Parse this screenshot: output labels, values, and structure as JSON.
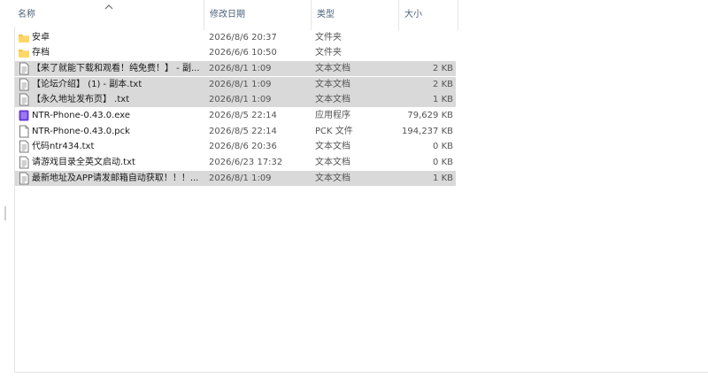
{
  "columns": {
    "name": "名称",
    "date_modified": "修改日期",
    "type": "类型",
    "size": "大小"
  },
  "sort_indicator": "chevron-up-icon",
  "files": [
    {
      "name": "安卓",
      "date": "2026/8/6 20:37",
      "type": "文件夹",
      "size": "",
      "icon": "folder-icon",
      "selected": false
    },
    {
      "name": "存档",
      "date": "2026/6/6 10:50",
      "type": "文件夹",
      "size": "",
      "icon": "folder-icon",
      "selected": false
    },
    {
      "name": "【来了就能下载和观看！纯免费！】 - 副...",
      "date": "2026/8/1 1:09",
      "type": "文本文档",
      "size": "2 KB",
      "icon": "text-file-icon",
      "selected": true
    },
    {
      "name": "【论坛介绍】 (1) - 副本.txt",
      "date": "2026/8/1 1:09",
      "type": "文本文档",
      "size": "2 KB",
      "icon": "text-file-icon",
      "selected": true
    },
    {
      "name": "【永久地址发布页】 .txt",
      "date": "2026/8/1 1:09",
      "type": "文本文档",
      "size": "1 KB",
      "icon": "text-file-icon",
      "selected": true
    },
    {
      "name": "NTR-Phone-0.43.0.exe",
      "date": "2026/8/5 22:14",
      "type": "应用程序",
      "size": "79,629 KB",
      "icon": "app-icon",
      "selected": false
    },
    {
      "name": "NTR-Phone-0.43.0.pck",
      "date": "2026/8/5 22:14",
      "type": "PCK 文件",
      "size": "194,237 KB",
      "icon": "blank-file-icon",
      "selected": false
    },
    {
      "name": "代码ntr434.txt",
      "date": "2026/8/6 20:36",
      "type": "文本文档",
      "size": "0 KB",
      "icon": "text-file-icon",
      "selected": false
    },
    {
      "name": "请游戏目录全英文启动.txt",
      "date": "2026/6/23 17:32",
      "type": "文本文档",
      "size": "0 KB",
      "icon": "text-file-icon",
      "selected": false
    },
    {
      "name": "最新地址及APP请发邮箱自动获取！！！...",
      "date": "2026/8/1 1:09",
      "type": "文本文档",
      "size": "1 KB",
      "icon": "text-file-icon",
      "selected": true
    }
  ],
  "colors": {
    "header_text": "#4c607a",
    "selection": "#d9d9d9",
    "folder": "#f5c343",
    "app_icon": "#6a3fd6"
  }
}
